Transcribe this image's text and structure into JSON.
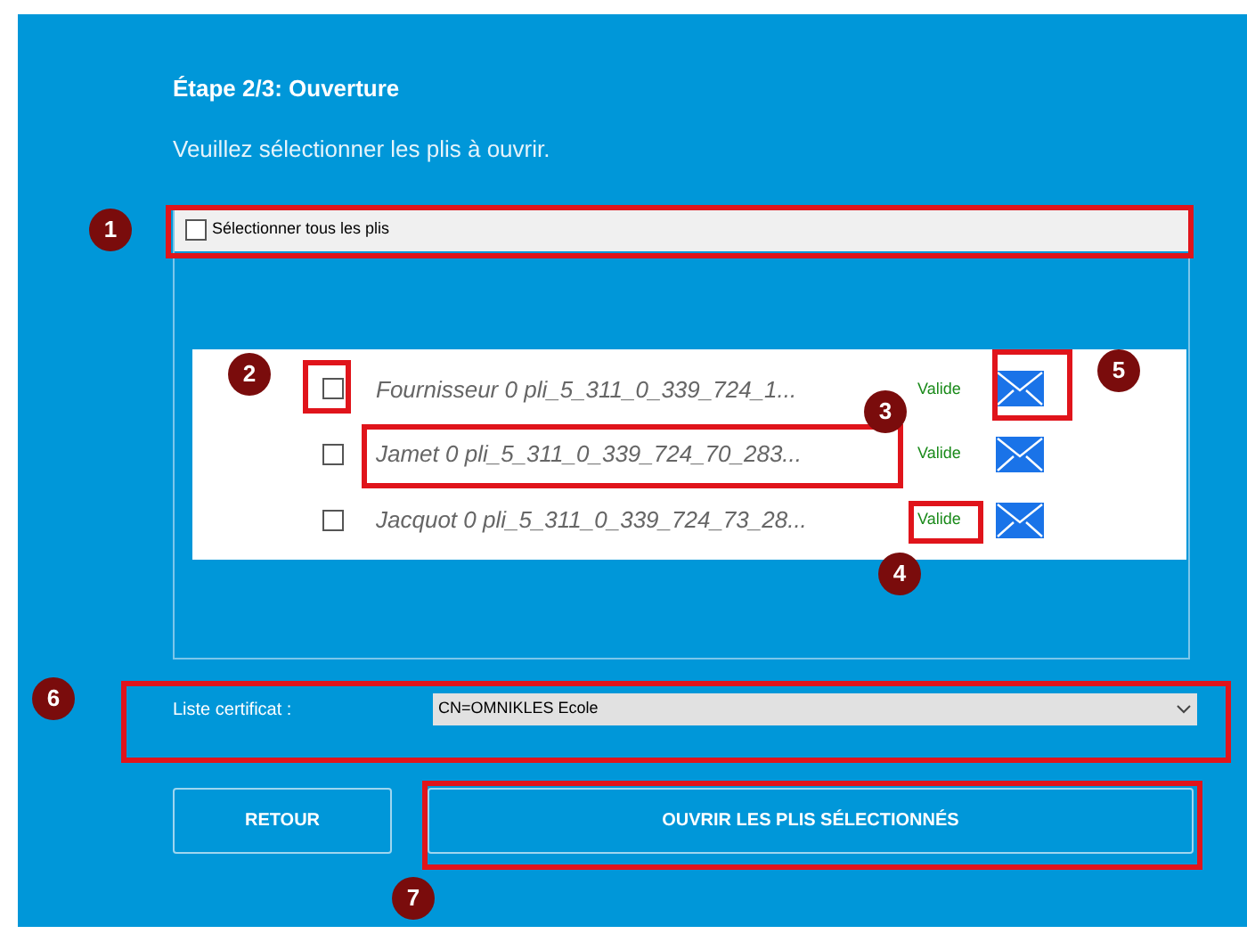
{
  "title": "Étape 2/3: Ouverture",
  "instruction": "Veuillez sélectionner les plis à ouvrir.",
  "select_all": {
    "label": "Sélectionner tous les plis",
    "checked": false
  },
  "plis": [
    {
      "name": "Fournisseur 0 pli_5_311_0_339_724_1...",
      "status": "Valide",
      "checked": false
    },
    {
      "name": "Jamet 0 pli_5_311_0_339_724_70_283...",
      "status": "Valide",
      "checked": false
    },
    {
      "name": "Jacquot 0 pli_5_311_0_339_724_73_28...",
      "status": "Valide",
      "checked": false
    }
  ],
  "certificate": {
    "label": "Liste certificat :",
    "value": "CN=OMNIKLES Ecole"
  },
  "buttons": [
    "RETOUR",
    "OUVRIR LES PLIS SÉLECTIONNÉS"
  ],
  "annotations": [
    "1",
    "2",
    "3",
    "4",
    "5",
    "6",
    "7"
  ]
}
